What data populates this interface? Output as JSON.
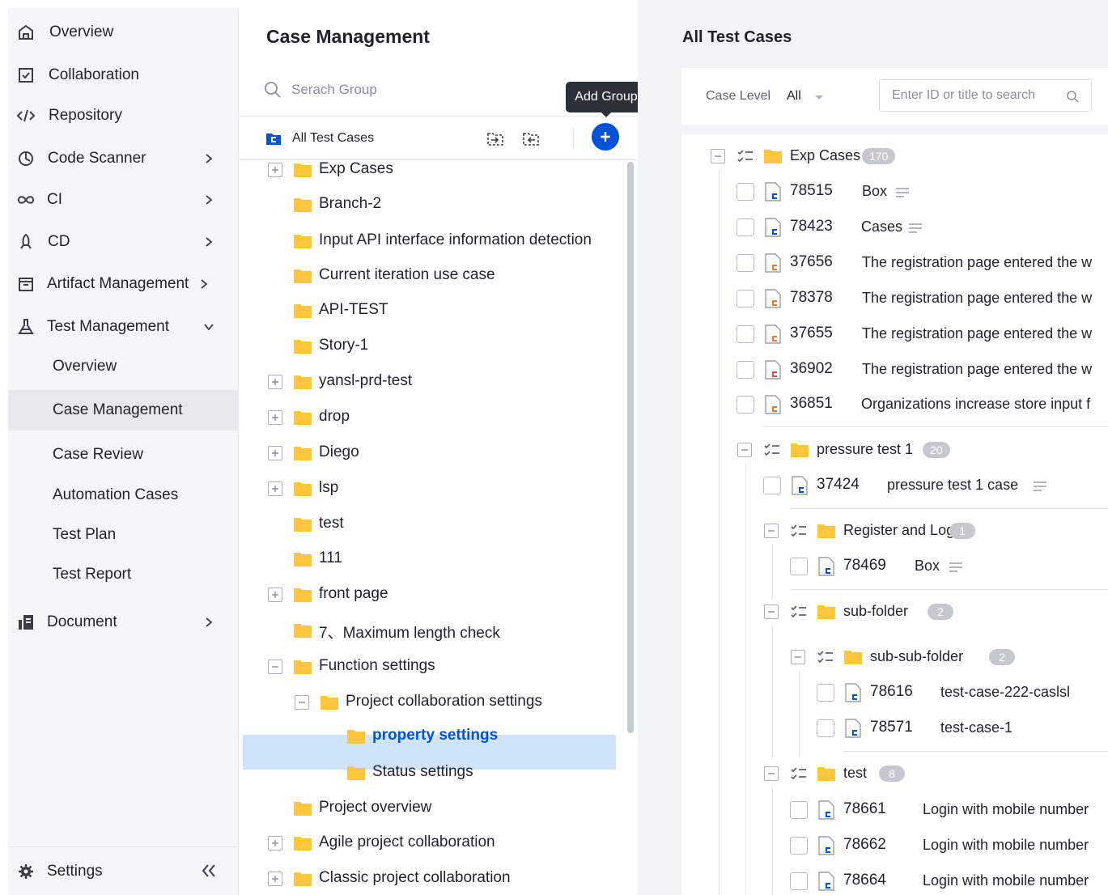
{
  "sidebar": {
    "items": [
      {
        "label": "Overview",
        "icon": "home-icon"
      },
      {
        "label": "Collaboration",
        "icon": "collaboration-icon"
      },
      {
        "label": "Repository",
        "icon": "code-icon"
      },
      {
        "label": "Code Scanner",
        "icon": "scanner-icon"
      },
      {
        "label": "CI",
        "icon": "infinity-icon"
      },
      {
        "label": "CD",
        "icon": "rocket-icon"
      },
      {
        "label": "Artifact Management",
        "icon": "artifact-icon"
      },
      {
        "label": "Test Management",
        "icon": "flask-icon"
      }
    ],
    "sub_items": [
      "Overview",
      "Case Management",
      "Case Review",
      "Automation Cases",
      "Test Plan",
      "Test Report"
    ],
    "document": "Document",
    "settings": "Settings",
    "active_item": "Case Management"
  },
  "middle": {
    "title": "Case Management",
    "search_placeholder": "Serach Group",
    "all_label": "All Test Cases",
    "tooltip": "Add Group",
    "tree": [
      {
        "label": "Exp Cases",
        "expander": "plus"
      },
      {
        "label": "Branch-2",
        "expander": ""
      },
      {
        "label": "Input API interface information detection",
        "expander": ""
      },
      {
        "label": "Current iteration use case",
        "expander": ""
      },
      {
        "label": "API-TEST",
        "expander": ""
      },
      {
        "label": "Story-1",
        "expander": ""
      },
      {
        "label": "yansl-prd-test",
        "expander": "plus"
      },
      {
        "label": "drop",
        "expander": "plus"
      },
      {
        "label": "Diego",
        "expander": "plus"
      },
      {
        "label": "lsp",
        "expander": "plus"
      },
      {
        "label": "test",
        "expander": ""
      },
      {
        "label": "111",
        "expander": ""
      },
      {
        "label": "front page",
        "expander": "plus"
      },
      {
        "label": "7、Maximum length check",
        "expander": ""
      },
      {
        "label": "Function settings",
        "expander": "minus"
      },
      {
        "label": "Project collaboration settings",
        "expander": "minus"
      },
      {
        "label": "property settings",
        "expander": "",
        "selected": true
      },
      {
        "label": "Status settings",
        "expander": ""
      },
      {
        "label": "Project overview",
        "expander": ""
      },
      {
        "label": "Agile project collaboration",
        "expander": "plus"
      },
      {
        "label": "Classic project collaboration",
        "expander": "plus"
      }
    ]
  },
  "right": {
    "title": "All Test Cases",
    "filter_label": "Case Level",
    "filter_value": "All",
    "search_placeholder": "Enter ID or title to search",
    "groups": [
      {
        "name": "Exp Cases",
        "count": "170"
      },
      {
        "name": "pressure test 1",
        "count": "20"
      },
      {
        "name": "Register and Login",
        "count": "1"
      },
      {
        "name": "sub-folder",
        "count": "2"
      },
      {
        "name": "sub-sub-folder",
        "count": "2"
      },
      {
        "name": "test",
        "count": "8"
      }
    ],
    "cases": [
      {
        "id": "78515",
        "title": "Box",
        "menu": true,
        "mark": "#0052d9"
      },
      {
        "id": "78423",
        "title": "Cases",
        "menu": true,
        "mark": "#0052d9"
      },
      {
        "id": "37656",
        "title": "The registration page entered the w",
        "menu": false,
        "mark": "#ed7b2f"
      },
      {
        "id": "78378",
        "title": "The registration page entered the w",
        "menu": false,
        "mark": "#ed7b2f"
      },
      {
        "id": "37655",
        "title": "The registration page entered the w",
        "menu": false,
        "mark": "#ed7b2f"
      },
      {
        "id": "36902",
        "title": "The registration page entered the w",
        "menu": false,
        "mark": "#e34d59"
      },
      {
        "id": "36851",
        "title": "Organizations increase store input f",
        "menu": false,
        "mark": "#ed7b2f"
      },
      {
        "id": "37424",
        "title": "pressure test 1 case",
        "menu": true,
        "mark": "#0052d9"
      },
      {
        "id": "78469",
        "title": "Box",
        "menu": true,
        "mark": "#0052d9"
      },
      {
        "id": "78616",
        "title": "test-case-222-caslsl",
        "menu": false,
        "mark": "#0052d9"
      },
      {
        "id": "78571",
        "title": "test-case-1",
        "menu": false,
        "mark": "#0052d9"
      },
      {
        "id": "78661",
        "title": "Login with mobile number",
        "menu": false,
        "mark": "#0052d9"
      },
      {
        "id": "78662",
        "title": "Login with mobile number",
        "menu": false,
        "mark": "#0052d9"
      },
      {
        "id": "78664",
        "title": "Login with mobile number",
        "menu": false,
        "mark": "#0052d9"
      }
    ]
  },
  "colors": {
    "accent": "#0052d9",
    "folder": "#ffc53d",
    "selected_bg": "#cfe4fb"
  }
}
